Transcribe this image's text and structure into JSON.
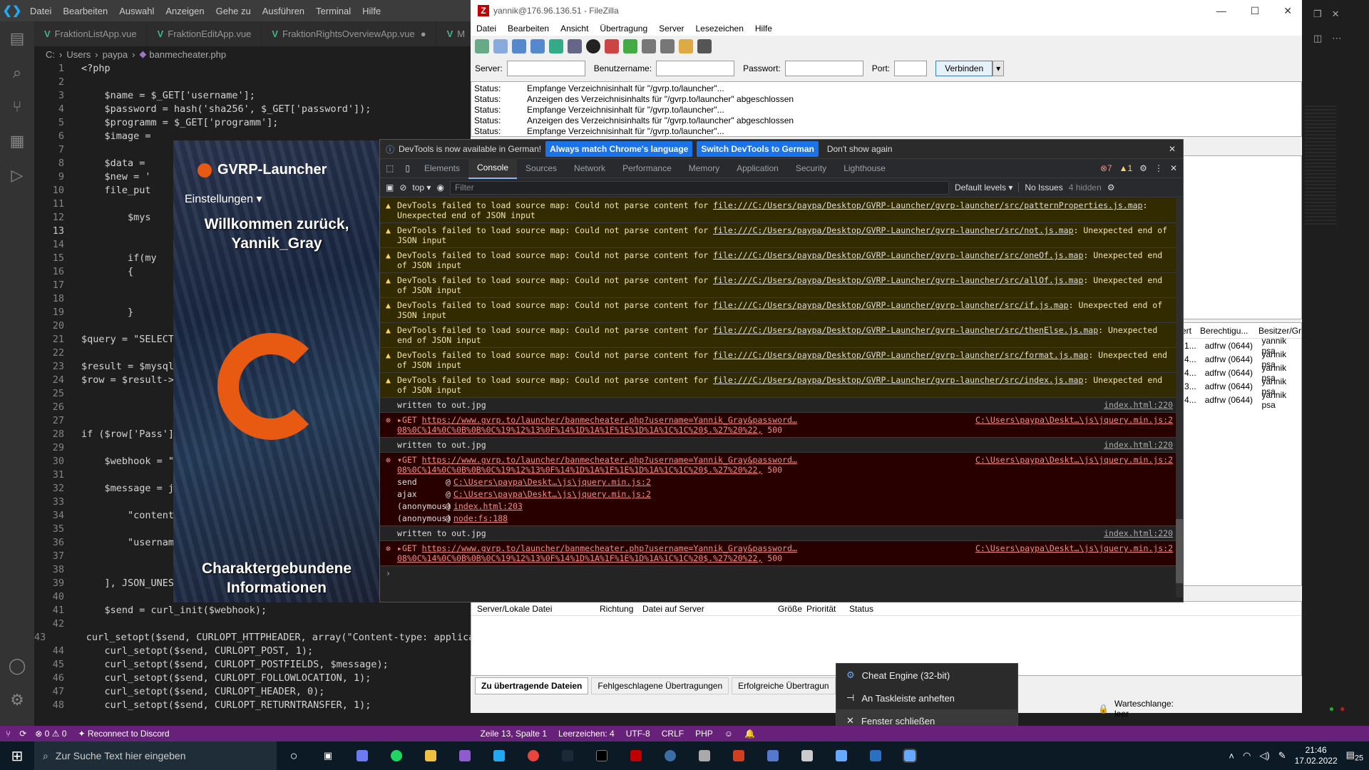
{
  "vscode": {
    "menu": [
      "Datei",
      "Bearbeiten",
      "Auswahl",
      "Anzeigen",
      "Gehe zu",
      "Ausführen",
      "Terminal",
      "Hilfe"
    ],
    "tabs": [
      "FraktionListApp.vue",
      "FraktionEditApp.vue",
      "FraktionRightsOverviewApp.vue",
      "M"
    ],
    "breadcrumb": [
      "C:",
      "Users",
      "paypa",
      "banmecheater.php"
    ],
    "code": [
      {
        "n": "1",
        "t": "<?php"
      },
      {
        "n": "2",
        "t": ""
      },
      {
        "n": "3",
        "t": "    $name = $_GET['username'];"
      },
      {
        "n": "4",
        "t": "    $password = hash('sha256', $_GET['password']);"
      },
      {
        "n": "5",
        "t": "    $programm = $_GET['programm'];"
      },
      {
        "n": "6",
        "t": "    $image ="
      },
      {
        "n": "7",
        "t": ""
      },
      {
        "n": "8",
        "t": "    $data ="
      },
      {
        "n": "9",
        "t": "    $new = '"
      },
      {
        "n": "10",
        "t": "    file_put"
      },
      {
        "n": "11",
        "t": ""
      },
      {
        "n": "12",
        "t": "        $mys"
      },
      {
        "n": "13",
        "t": ""
      },
      {
        "n": "14",
        "t": ""
      },
      {
        "n": "15",
        "t": "        if(my"
      },
      {
        "n": "16",
        "t": "        {"
      },
      {
        "n": "17",
        "t": ""
      },
      {
        "n": "18",
        "t": ""
      },
      {
        "n": "19",
        "t": "        }"
      },
      {
        "n": "20",
        "t": ""
      },
      {
        "n": "21",
        "t": "$query = \"SELECT"
      },
      {
        "n": "22",
        "t": ""
      },
      {
        "n": "23",
        "t": "$result = $mysql"
      },
      {
        "n": "24",
        "t": "$row = $result->"
      },
      {
        "n": "25",
        "t": ""
      },
      {
        "n": "26",
        "t": ""
      },
      {
        "n": "27",
        "t": ""
      },
      {
        "n": "28",
        "t": "if ($row['Pass']"
      },
      {
        "n": "29",
        "t": ""
      },
      {
        "n": "30",
        "t": "    $webhook = \""
      },
      {
        "n": "31",
        "t": ""
      },
      {
        "n": "32",
        "t": "    $message = j"
      },
      {
        "n": "33",
        "t": ""
      },
      {
        "n": "34",
        "t": "        \"content"
      },
      {
        "n": "35",
        "t": ""
      },
      {
        "n": "36",
        "t": "        \"username"
      },
      {
        "n": "37",
        "t": ""
      },
      {
        "n": "38",
        "t": ""
      },
      {
        "n": "39",
        "t": "    ], JSON_UNESC"
      },
      {
        "n": "40",
        "t": ""
      },
      {
        "n": "41",
        "t": "    $send = curl_init($webhook);"
      },
      {
        "n": "42",
        "t": ""
      },
      {
        "n": "43",
        "t": "    curl_setopt($send, CURLOPT_HTTPHEADER, array(\"Content-type: applica"
      },
      {
        "n": "44",
        "t": "    curl_setopt($send, CURLOPT_POST, 1);"
      },
      {
        "n": "45",
        "t": "    curl_setopt($send, CURLOPT_POSTFIELDS, $message);"
      },
      {
        "n": "46",
        "t": "    curl_setopt($send, CURLOPT_FOLLOWLOCATION, 1);"
      },
      {
        "n": "47",
        "t": "    curl_setopt($send, CURLOPT_HEADER, 0);"
      },
      {
        "n": "48",
        "t": "    curl_setopt($send, CURLOPT_RETURNTRANSFER, 1);"
      }
    ],
    "status": {
      "errors": "0",
      "warnings": "0",
      "discord": "Reconnect to Discord",
      "pos": "Zeile 13, Spalte 1",
      "spaces": "Leerzeichen: 4",
      "enc": "UTF-8",
      "eol": "CRLF",
      "lang": "PHP"
    }
  },
  "launcher": {
    "title": "GVRP-Launcher",
    "settings": "Einstellungen",
    "welcome": "Willkommen zurück, Yannik_Gray",
    "footer": "Charaktergebundene Informationen"
  },
  "filezilla": {
    "title": "yannik@176.96.136.51 - FileZilla",
    "menu": [
      "Datei",
      "Bearbeiten",
      "Ansicht",
      "Übertragung",
      "Server",
      "Lesezeichen",
      "Hilfe"
    ],
    "quick": {
      "server": "Server:",
      "user": "Benutzername:",
      "pass": "Passwort:",
      "port": "Port:",
      "connect": "Verbinden"
    },
    "log": [
      {
        "k": "Status:",
        "v": "Empfange Verzeichnisinhalt für \"/gvrp.to/launcher\"..."
      },
      {
        "k": "Status:",
        "v": "Anzeigen des Verzeichnisinhalts für \"/gvrp.to/launcher\" abgeschlossen"
      },
      {
        "k": "Status:",
        "v": "Empfange Verzeichnisinhalt für \"/gvrp.to/launcher\"..."
      },
      {
        "k": "Status:",
        "v": "Anzeigen des Verzeichnisinhalts für \"/gvrp.to/launcher\" abgeschlossen"
      },
      {
        "k": "Status:",
        "v": "Empfange Verzeichnisinhalt für \"/gvrp.to/launcher\"..."
      }
    ],
    "remote_headers": [
      "ert",
      "Berechtigu...",
      "Besitzer/Gr"
    ],
    "remote_rows": [
      {
        "a": "1...",
        "b": "adfrw (0644)",
        "c": "yannik psa"
      },
      {
        "a": "4...",
        "b": "adfrw (0644)",
        "c": "yannik psa"
      },
      {
        "a": "4...",
        "b": "adfrw (0644)",
        "c": "yannik psa"
      },
      {
        "a": "3...",
        "b": "adfrw (0644)",
        "c": "yannik psa"
      },
      {
        "a": "4...",
        "b": "adfrw (0644)",
        "c": "yannik psa"
      }
    ],
    "queue_headers": [
      "Server/Lokale Datei",
      "Richtung",
      "Datei auf Server",
      "Größe",
      "Priorität",
      "Status"
    ],
    "queue_tabs": [
      "Zu übertragende Dateien",
      "Fehlgeschlagene Übertragungen",
      "Erfolgreiche Übertragun"
    ],
    "queue_status": "Warteschlange: leer"
  },
  "devtools": {
    "info": "DevTools is now available in German!",
    "btn1": "Always match Chrome's language",
    "btn2": "Switch DevTools to German",
    "btn3": "Don't show again",
    "tabs": [
      "Elements",
      "Console",
      "Sources",
      "Network",
      "Performance",
      "Memory",
      "Application",
      "Security",
      "Lighthouse"
    ],
    "badges": {
      "err": "7",
      "warn": "1"
    },
    "context": "top",
    "filter": "Filter",
    "levels": "Default levels",
    "issues": "No Issues",
    "hidden": "4 hidden",
    "warnings": [
      {
        "pre": "DevTools failed to load source map: Could not parse content for ",
        "url": "file:///C:/Users/paypa/Desktop/GVRP-Launcher/gvrp-launcher/src/patternProperties.js.map",
        "post": ": Unexpected end of JSON input"
      },
      {
        "pre": "DevTools failed to load source map: Could not parse content for ",
        "url": "file:///C:/Users/paypa/Desktop/GVRP-Launcher/gvrp-launcher/src/not.js.map",
        "post": ": Unexpected end of JSON input"
      },
      {
        "pre": "DevTools failed to load source map: Could not parse content for ",
        "url": "file:///C:/Users/paypa/Desktop/GVRP-Launcher/gvrp-launcher/src/oneOf.js.map",
        "post": ": Unexpected end of JSON input"
      },
      {
        "pre": "DevTools failed to load source map: Could not parse content for ",
        "url": "file:///C:/Users/paypa/Desktop/GVRP-Launcher/gvrp-launcher/src/allOf.js.map",
        "post": ": Unexpected end of JSON input"
      },
      {
        "pre": "DevTools failed to load source map: Could not parse content for ",
        "url": "file:///C:/Users/paypa/Desktop/GVRP-Launcher/gvrp-launcher/src/if.js.map",
        "post": ": Unexpected end of JSON input"
      },
      {
        "pre": "DevTools failed to load source map: Could not parse content for ",
        "url": "file:///C:/Users/paypa/Desktop/GVRP-Launcher/gvrp-launcher/src/thenElse.js.map",
        "post": ": Unexpected end of JSON input"
      },
      {
        "pre": "DevTools failed to load source map: Could not parse content for ",
        "url": "file:///C:/Users/paypa/Desktop/GVRP-Launcher/gvrp-launcher/src/format.js.map",
        "post": ": Unexpected end of JSON input"
      },
      {
        "pre": "DevTools failed to load source map: Could not parse content for ",
        "url": "file:///C:/Users/paypa/Desktop/GVRP-Launcher/gvrp-launcher/src/index.js.map",
        "post": ": Unexpected end of JSON input"
      }
    ],
    "written": "written to out.jpg",
    "written_src": "index.html:220",
    "get_url": "https://www.gvrp.to/launcher/banmecheater.php?username=Yannik_Gray&password…08%0C%14%0C%0B%0B%0C%19%12%13%0F%14%1D%1A%1F%1E%1D%1A%1C%1C%20$.%27%20%22,",
    "get_code": "500",
    "get_src": "C:\\Users\\paypa\\Deskt…\\js\\jquery.min.js:2",
    "stack": [
      {
        "fn": "send",
        "loc": "C:\\Users\\paypa\\Deskt…\\js\\jquery.min.js:2"
      },
      {
        "fn": "ajax",
        "loc": "C:\\Users\\paypa\\Deskt…\\js\\jquery.min.js:2"
      },
      {
        "fn": "(anonymous)",
        "loc": "index.html:203"
      },
      {
        "fn": "(anonymous)",
        "loc": "node:fs:188"
      }
    ]
  },
  "context_menu": [
    "Cheat Engine (32-bit)",
    "An Taskleiste anheften",
    "Fenster schließen"
  ],
  "taskbar": {
    "search": "Zur Suche Text hier eingeben",
    "time": "21:46",
    "date": "17.02.2022",
    "notif": "25"
  }
}
